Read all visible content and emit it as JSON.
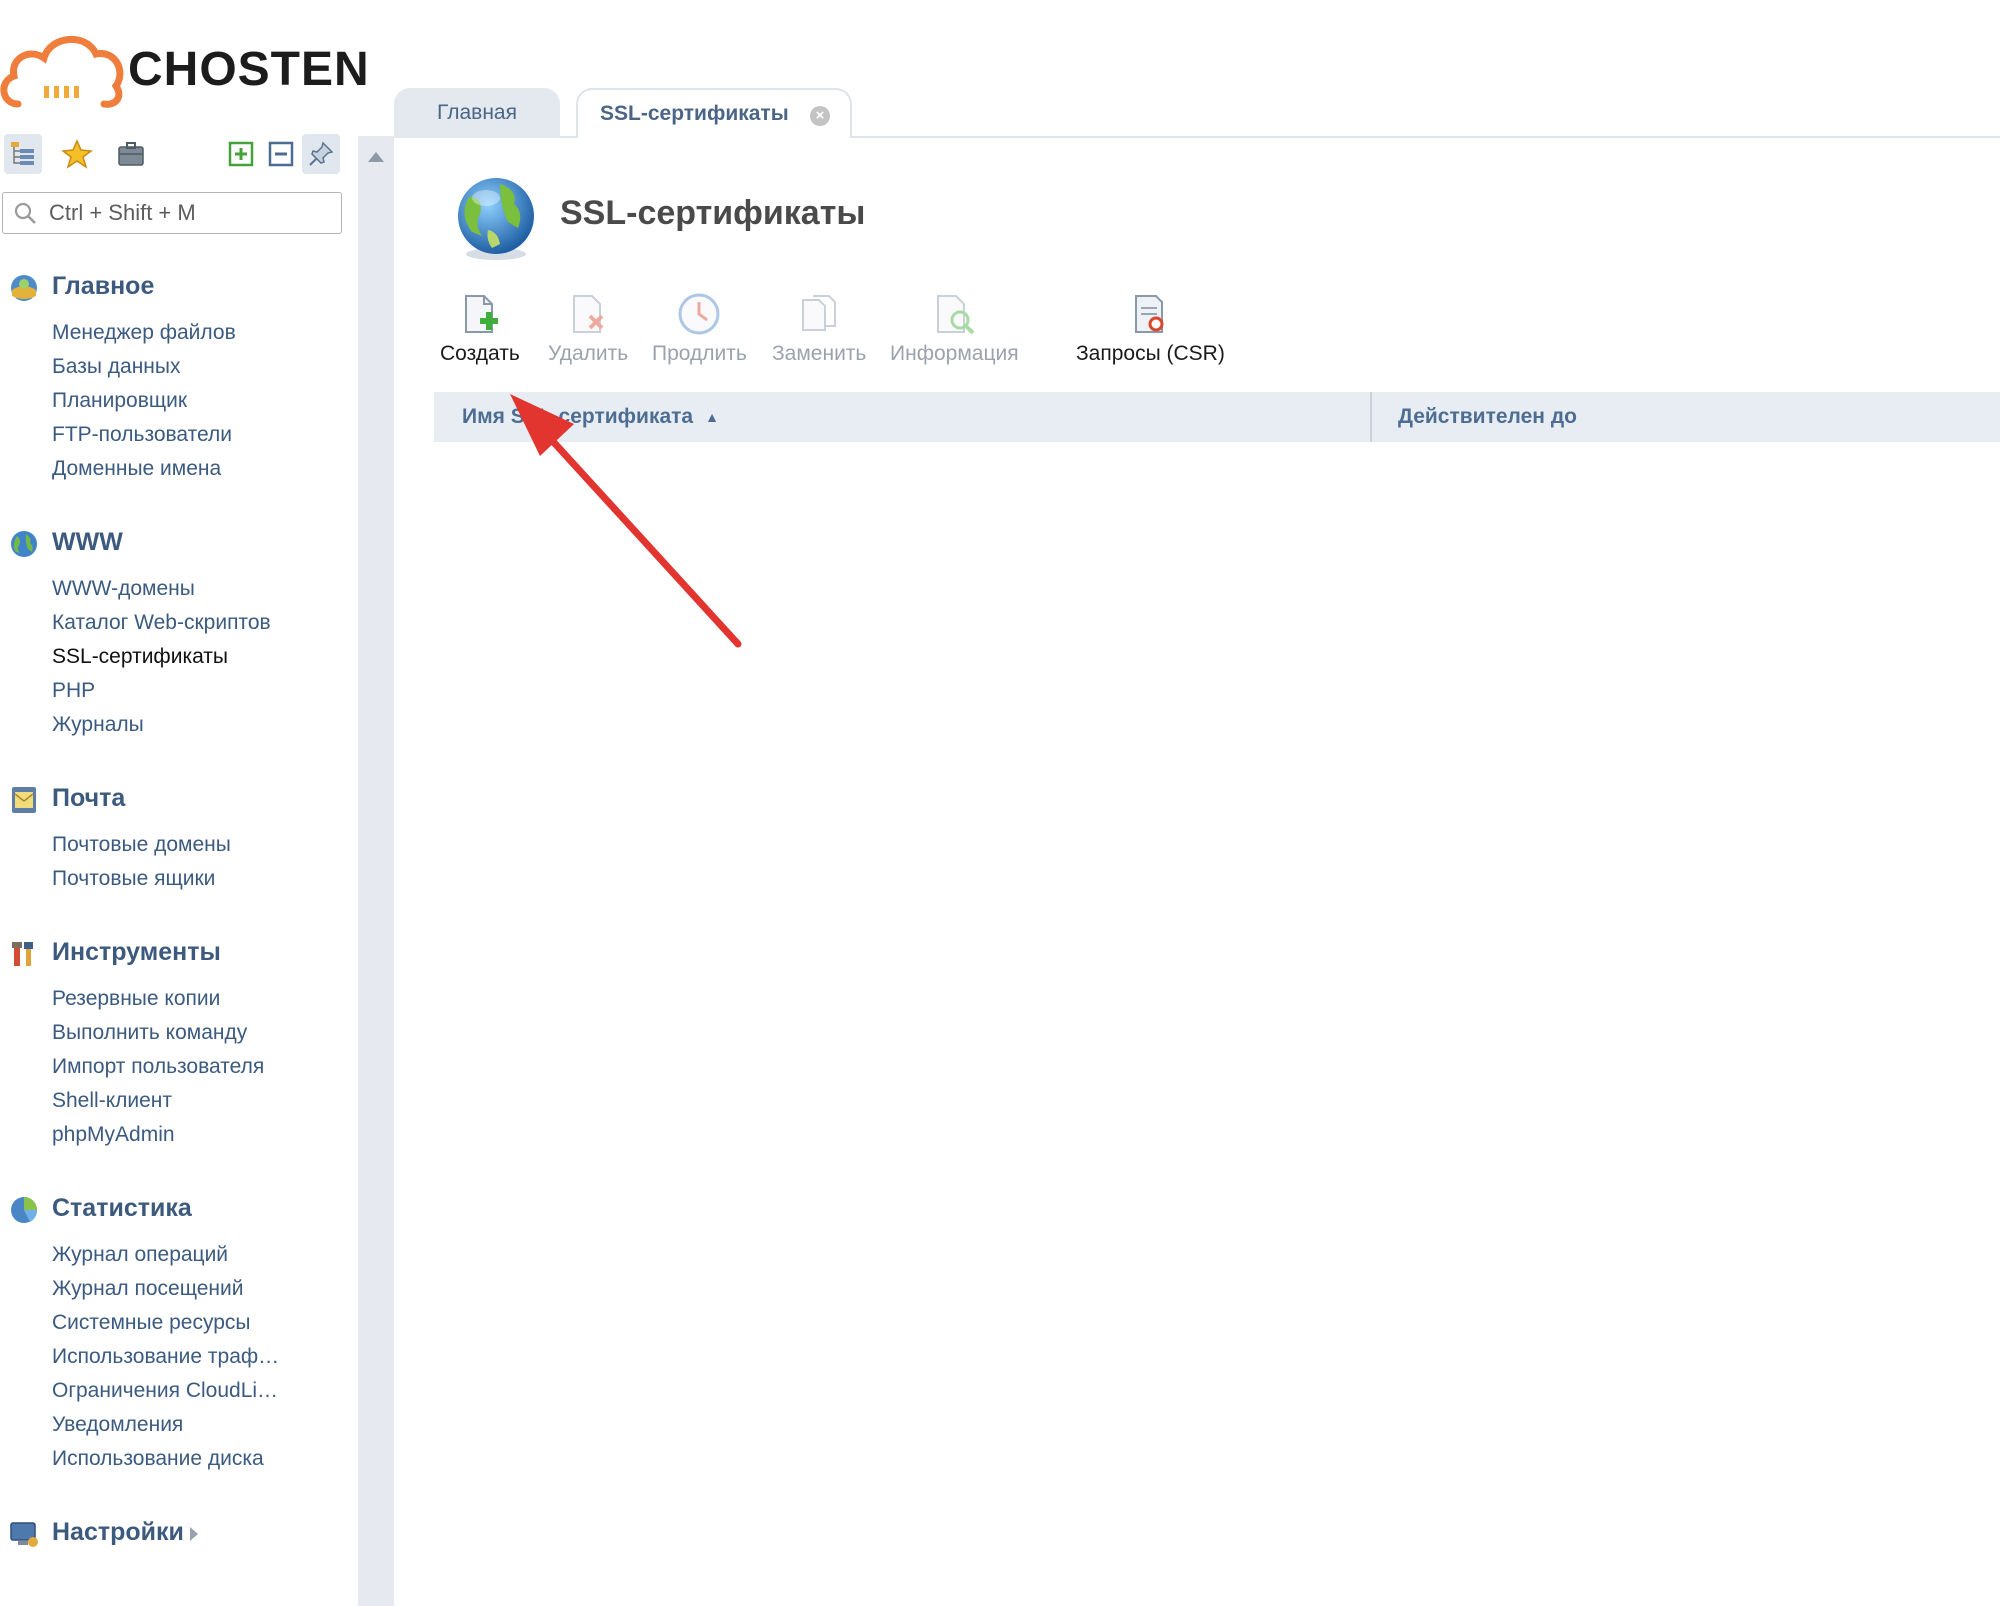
{
  "app": {
    "logo_text": "CHOSTEN"
  },
  "sidebar": {
    "search_placeholder": "Ctrl + Shift + M",
    "toolbar": {
      "tree_view": "tree-view-icon",
      "favorites": "star-icon",
      "briefcase": "briefcase-icon",
      "expand_all": "plus-box-icon",
      "collapse_all": "minus-box-icon",
      "pin": "pin-icon"
    },
    "sections": [
      {
        "title": "Главное",
        "icon": "home-icon",
        "items": [
          "Менеджер файлов",
          "Базы данных",
          "Планировщик",
          "FTP-пользователи",
          "Доменные имена"
        ]
      },
      {
        "title": "WWW",
        "icon": "globe-icon",
        "items": [
          "WWW-домены",
          "Каталог Web-скриптов",
          "SSL-сертификаты",
          "PHP",
          "Журналы"
        ]
      },
      {
        "title": "Почта",
        "icon": "mail-icon",
        "items": [
          "Почтовые домены",
          "Почтовые ящики"
        ]
      },
      {
        "title": "Инструменты",
        "icon": "tools-icon",
        "items": [
          "Резервные копии",
          "Выполнить команду",
          "Импорт пользователя",
          "Shell-клиент",
          "phpMyAdmin"
        ]
      },
      {
        "title": "Статистика",
        "icon": "pie-chart-icon",
        "items": [
          "Журнал операций",
          "Журнал посещений",
          "Системные ресурсы",
          "Использование траф…",
          "Ограничения CloudLi…",
          "Уведомления",
          "Использование диска"
        ]
      },
      {
        "title": "Настройки",
        "icon": "settings-monitor-icon",
        "items": []
      }
    ],
    "current_item": "SSL-сертификаты"
  },
  "tabs": [
    {
      "label": "Главная",
      "active": false
    },
    {
      "label": "SSL-сертификаты",
      "active": true
    }
  ],
  "main": {
    "title": "SSL-сертификаты",
    "actions": [
      {
        "label": "Создать",
        "icon": "create-doc-icon",
        "enabled": true
      },
      {
        "label": "Удалить",
        "icon": "delete-doc-icon",
        "enabled": false
      },
      {
        "label": "Продлить",
        "icon": "clock-icon",
        "enabled": false
      },
      {
        "label": "Заменить",
        "icon": "replace-doc-icon",
        "enabled": false
      },
      {
        "label": "Информация",
        "icon": "info-search-icon",
        "enabled": false
      },
      {
        "label": "Запросы (CSR)",
        "icon": "csr-doc-icon",
        "enabled": true
      }
    ],
    "grid": {
      "columns": [
        {
          "label": "Имя SSL-сертификата",
          "sort": "asc"
        },
        {
          "label": "Действителен до"
        }
      ],
      "rows": []
    }
  },
  "colors": {
    "accent_text": "#3b5a80",
    "annotation_arrow": "#e2352f",
    "logo_cloud": "#ef7d3c"
  }
}
